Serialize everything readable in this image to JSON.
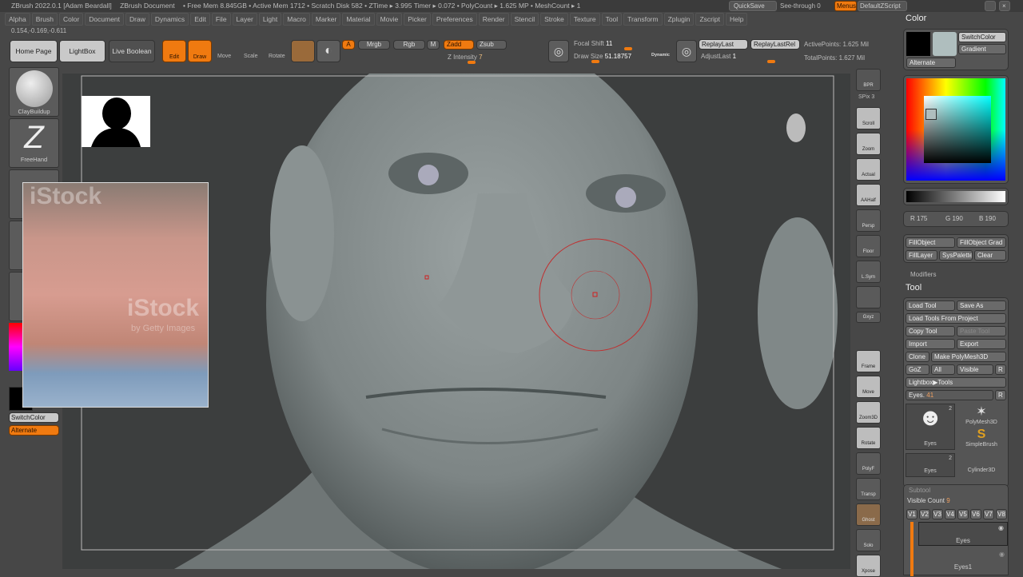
{
  "titlebar": {
    "app": "ZBrush 2022.0.1 [Adam Beardall]",
    "doc": "ZBrush Document",
    "stats": "• Free Mem 8.845GB • Active Mem 1712 • Scratch Disk 582 • ZTime ▸ 3.995 Timer ▸ 0.072 • PolyCount ▸ 1.625 MP • MeshCount ▸ 1",
    "quicksave": "QuickSave",
    "seethrough": "See-through  0",
    "menus": "Menus",
    "script": "DefaultZScript"
  },
  "menu": [
    "Alpha",
    "Brush",
    "Color",
    "Document",
    "Draw",
    "Dynamics",
    "Edit",
    "File",
    "Layer",
    "Light",
    "Macro",
    "Marker",
    "Material",
    "Movie",
    "Picker",
    "Preferences",
    "Render",
    "Stencil",
    "Stroke",
    "Texture",
    "Tool",
    "Transform",
    "Zplugin",
    "Zscript",
    "Help"
  ],
  "coords": "0.154,-0.169,-0.611",
  "toolbar": {
    "home": "Home Page",
    "lightbox": "LightBox",
    "liveboolean": "Live Boolean",
    "edit": "Edit",
    "draw": "Draw",
    "move": "Move",
    "scale": "Scale",
    "rotate": "Rotate",
    "a": "A",
    "mrgb": "Mrgb",
    "rgb": "Rgb",
    "m": "M",
    "zadd": "Zadd",
    "zsub": "Zsub",
    "zintensity_label": "Z Intensity",
    "zintensity": "7",
    "focal_label": "Focal Shift",
    "focal": "11",
    "drawsize_label": "Draw Size",
    "drawsize": "51.18757",
    "dynamic": "Dynamic",
    "replaylast": "ReplayLast",
    "replaylastrel": "ReplayLastRel",
    "adjustlast_label": "AdjustLast",
    "adjustlast": "1",
    "activepoints": "ActivePoints: 1.625 Mil",
    "totalpoints": "TotalPoints: 1.627 Mil"
  },
  "shelf": {
    "brush": "ClayBuildup",
    "stroke": "FreeHand",
    "switchcolor": "SwitchColor",
    "alternate": "Alternate"
  },
  "reference": {
    "watermark": "iStock",
    "sub": "by Getty Images"
  },
  "righttools": [
    "BPR",
    "Scroll",
    "Zoom",
    "Actual",
    "AAHalf",
    "Persp",
    "Floor",
    "L.Sym",
    "",
    "Gxyz",
    "Frame",
    "Move",
    "Zoom3D",
    "Rotate",
    "PolyF",
    "Transp",
    "Ghost",
    "Solo",
    "Xpose"
  ],
  "spix": "SPix 3",
  "color": {
    "title": "Color",
    "switchcolor": "SwitchColor",
    "gradient": "Gradient",
    "alternate": "Alternate",
    "r": "R 175",
    "g": "G 190",
    "b": "B 190",
    "fillobject": "FillObject",
    "fillobjectgrad": "FillObject Grad",
    "filllayer": "FillLayer",
    "syspalette": "SysPalette",
    "clear": "Clear",
    "modifiers": "Modifiers",
    "main": "#afbebe"
  },
  "tool": {
    "title": "Tool",
    "loadtool": "Load Tool",
    "saveas": "Save As",
    "loadfromproject": "Load Tools From Project",
    "copytool": "Copy Tool",
    "pastetool": "Paste Tool",
    "import": "Import",
    "export": "Export",
    "clone": "Clone",
    "makepolymesh": "Make PolyMesh3D",
    "goz": "GoZ",
    "all": "All",
    "visible": "Visible",
    "r": "R",
    "lightboxtools": "Lightbox▶Tools",
    "eyes_label": "Eyes.",
    "eyes": "41",
    "thumbs": [
      {
        "name": "Eyes",
        "count": "2"
      },
      {
        "name": "PolyMesh3D"
      },
      {
        "name": "SimpleBrush"
      },
      {
        "name": "Eyes",
        "count": "2"
      },
      {
        "name": "Cylinder3D"
      }
    ]
  },
  "subtool": {
    "title": "Subtool",
    "visiblecount_label": "Visible Count",
    "visiblecount": "9",
    "vtabs": [
      "V1",
      "V2",
      "V3",
      "V4",
      "V5",
      "V6",
      "V7",
      "V8"
    ],
    "items": [
      "Eyes",
      "Eyes1"
    ]
  },
  "accent": "#f07a10"
}
